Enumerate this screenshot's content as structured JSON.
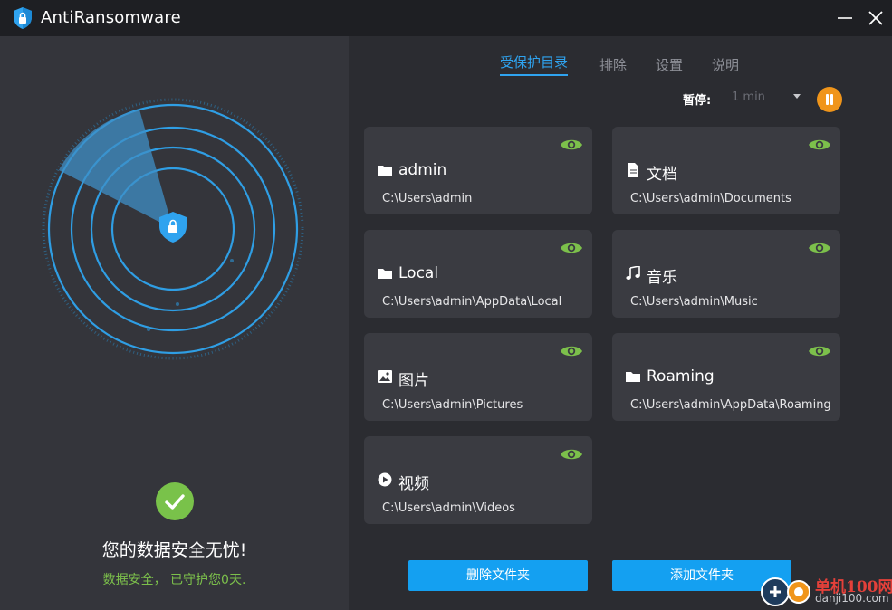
{
  "app": {
    "title": "AntiRansomware",
    "logo_icon": "shield-lock-icon",
    "accent_color": "#2fa3ef",
    "ok_color": "#7cc04b",
    "warn_color": "#f0951a"
  },
  "window_controls": {
    "minimize_icon": "minimize-icon",
    "close_icon": "close-icon"
  },
  "status": {
    "icon": "check-circle-icon",
    "title": "您的数据安全无忧!",
    "subtitle": "数据安全， 已守护您0天."
  },
  "tabs": [
    {
      "label": "受保护目录",
      "active": true
    },
    {
      "label": "排除",
      "active": false
    },
    {
      "label": "设置",
      "active": false
    },
    {
      "label": "说明",
      "active": false
    }
  ],
  "pause": {
    "label": "暂停:",
    "selected": "1 min",
    "button_icon": "pause-icon"
  },
  "folders": [
    {
      "name": "admin",
      "path": "C:\\Users\\admin",
      "icon": "folder-icon",
      "watched": true
    },
    {
      "name": "文档",
      "path": "C:\\Users\\admin\\Documents",
      "icon": "document-icon",
      "watched": true
    },
    {
      "name": "Local",
      "path": "C:\\Users\\admin\\AppData\\Local",
      "icon": "folder-icon",
      "watched": true
    },
    {
      "name": "音乐",
      "path": "C:\\Users\\admin\\Music",
      "icon": "music-icon",
      "watched": true
    },
    {
      "name": "图片",
      "path": "C:\\Users\\admin\\Pictures",
      "icon": "image-icon",
      "watched": true
    },
    {
      "name": "Roaming",
      "path": "C:\\Users\\admin\\AppData\\Roaming",
      "icon": "folder-icon",
      "watched": true
    },
    {
      "name": "视频",
      "path": "C:\\Users\\admin\\Videos",
      "icon": "play-circle-icon",
      "watched": true
    }
  ],
  "actions": {
    "delete_label": "删除文件夹",
    "add_label": "添加文件夹"
  },
  "watermark": {
    "line1": "单机100网",
    "line2": "danji100.com"
  }
}
